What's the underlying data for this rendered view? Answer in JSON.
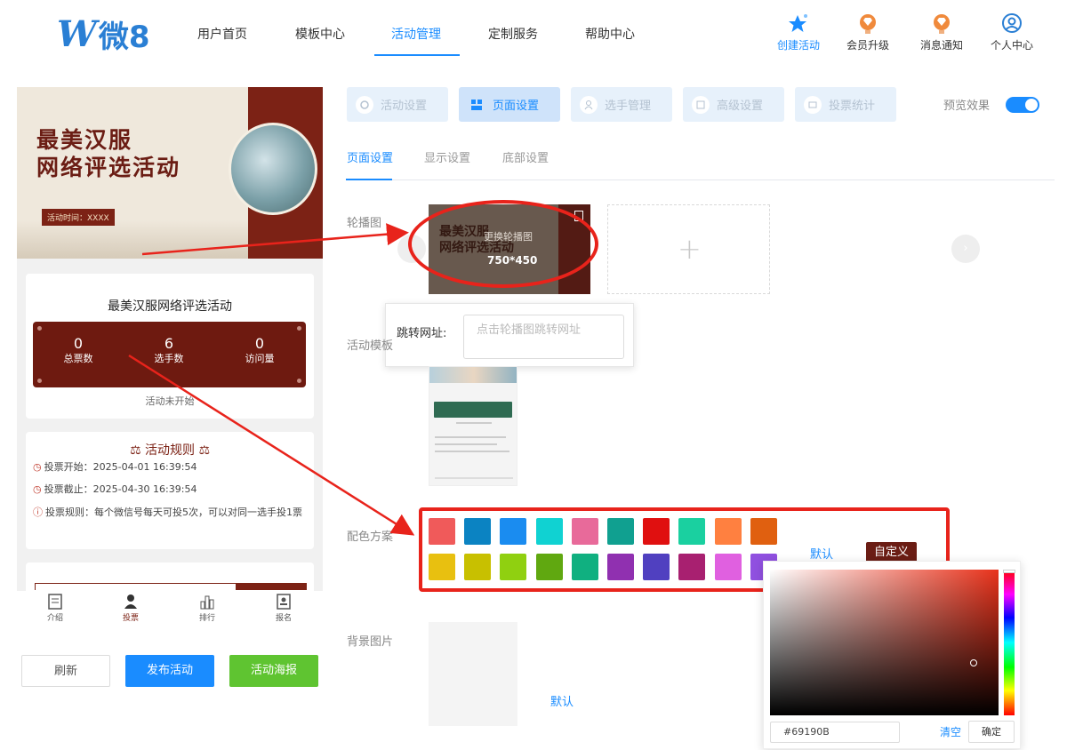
{
  "header": {
    "logo_letter": "W",
    "logo_text": "微8",
    "nav": [
      "用户首页",
      "模板中心",
      "活动管理",
      "定制服务",
      "帮助中心"
    ],
    "active_nav": "活动管理",
    "actions": [
      {
        "label": "创建活动",
        "icon": "star-sparkle-icon",
        "color": "#1a8cff"
      },
      {
        "label": "会员升级",
        "icon": "diamond-badge-icon",
        "color": "#f08a3c"
      },
      {
        "label": "消息通知",
        "icon": "bell-badge-icon",
        "color": "#f08a3c"
      },
      {
        "label": "个人中心",
        "icon": "user-circle-icon",
        "color": "#2a7fd4"
      }
    ]
  },
  "preview": {
    "banner_title_line1": "最美汉服",
    "banner_title_line2": "网络评选活动",
    "banner_time": "活动时间：XXXX",
    "activity_title": "最美汉服网络评选活动",
    "stats": [
      {
        "value": "0",
        "label": "总票数"
      },
      {
        "value": "6",
        "label": "选手数"
      },
      {
        "value": "0",
        "label": "访问量"
      }
    ],
    "status": "活动未开始",
    "rules_title": "活动规则",
    "rules": [
      {
        "label": "投票开始：",
        "value": "2025-04-01 16:39:54"
      },
      {
        "label": "投票截止：",
        "value": "2025-04-30 16:39:54"
      },
      {
        "label": "投票规则：",
        "value": "每个微信号每天可投5次，可以对同一选手投1票"
      }
    ],
    "tabbar": [
      {
        "label": "介绍",
        "icon": "document-icon"
      },
      {
        "label": "投票",
        "icon": "person-icon"
      },
      {
        "label": "排行",
        "icon": "bar-chart-icon"
      },
      {
        "label": "报名",
        "icon": "signup-icon"
      }
    ],
    "active_tab": "投票"
  },
  "left_buttons": {
    "refresh": "刷新",
    "publish": "发布活动",
    "poster": "活动海报"
  },
  "panel_tabs": [
    {
      "label": "活动设置",
      "icon": "clipboard-icon"
    },
    {
      "label": "页面设置",
      "icon": "layout-icon"
    },
    {
      "label": "选手管理",
      "icon": "user-icon"
    },
    {
      "label": "高级设置",
      "icon": "settings-icon"
    },
    {
      "label": "投票统计",
      "icon": "stats-icon"
    }
  ],
  "active_panel_tab": "页面设置",
  "preview_toggle": {
    "label": "预览效果",
    "on": true
  },
  "sub_tabs": [
    "页面设置",
    "显示设置",
    "底部设置"
  ],
  "active_sub_tab": "页面设置",
  "form": {
    "carousel_label": "轮播图",
    "carousel_hint": "更换轮播图",
    "carousel_size": "750*450",
    "redirect_label": "跳转网址:",
    "redirect_placeholder": "点击轮播图跳转网址",
    "template_label": "活动模板",
    "color_label": "配色方案",
    "colors_row1": [
      "#f05a5a",
      "#0b83c2",
      "#1a8cf0",
      "#10d2d2",
      "#e86a9a",
      "#10a090",
      "#e01010",
      "#1ad0a0",
      "#ff8040",
      "#e06010"
    ],
    "colors_row2": [
      "#e8c010",
      "#c8c000",
      "#90d010",
      "#60a810",
      "#10b080",
      "#9030b0",
      "#5040c0",
      "#a82070",
      "#e060e0",
      "#9050e0"
    ],
    "color_default": "默认",
    "color_custom": "自定义",
    "bg_label": "背景图片",
    "bg_default": "默认"
  },
  "color_picker": {
    "hex": "#69190B",
    "clear": "清空",
    "confirm": "确定"
  },
  "colors": {
    "accent": "#1a8cff",
    "brand_red": "#6e1a10",
    "annotation_red": "#e8231b",
    "publish_btn": "#1a8cff",
    "poster_btn": "#5fc431"
  }
}
